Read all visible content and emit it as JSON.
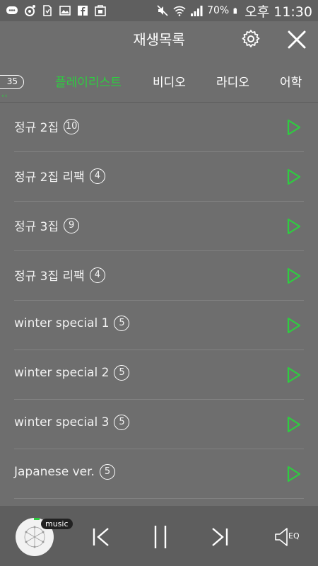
{
  "status_bar": {
    "battery": "70%",
    "time": "오후 11:30",
    "icons": [
      "chat-icon",
      "sync-icon",
      "sd-card-icon",
      "image-icon",
      "facebook-icon",
      "store-icon",
      "mute-icon",
      "wifi-icon",
      "signal-icon",
      "battery-icon"
    ]
  },
  "header": {
    "title": "재생목록",
    "settings_icon": "gear-icon",
    "close_icon": "close-icon"
  },
  "tabs": {
    "count": "35",
    "items": [
      {
        "label": "플레이리스트",
        "active": true
      },
      {
        "label": "비디오",
        "active": false
      },
      {
        "label": "라디오",
        "active": false
      },
      {
        "label": "어학",
        "active": false
      }
    ]
  },
  "playlists": [
    {
      "name": "정규 2집",
      "count": "10"
    },
    {
      "name": "정규 2집 리팩",
      "count": "4"
    },
    {
      "name": "정규 3집",
      "count": "9"
    },
    {
      "name": "정규 3집 리팩",
      "count": "4"
    },
    {
      "name": "winter special 1",
      "count": "5"
    },
    {
      "name": "winter special 2",
      "count": "5"
    },
    {
      "name": "winter special 3",
      "count": "5"
    },
    {
      "name": "Japanese ver.",
      "count": "5"
    }
  ],
  "player": {
    "tag": "music",
    "eq_label": "EQ"
  },
  "colors": {
    "accent": "#2ecc40",
    "background": "#6e6e6e",
    "player_background": "#5e5e5e"
  }
}
